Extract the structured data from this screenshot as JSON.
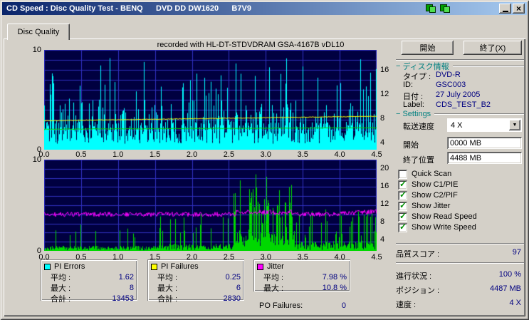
{
  "window": {
    "title": "CD Speed : Disc Quality Test - BENQ      DVD DD DW1620      B7V9"
  },
  "tab_label": "Disc Quality",
  "chart_data": {
    "annotation": "recorded with HL-DT-STDVDRAM GSA-4167B vDL10",
    "x_ticks": [
      "0.0",
      "0.5",
      "1.0",
      "1.5",
      "2.0",
      "2.5",
      "3.0",
      "3.5",
      "4.0",
      "4.5"
    ],
    "x_range": [
      0,
      4.5
    ],
    "charts": [
      {
        "id": "pi_errors",
        "type": "area",
        "bg": "#000040",
        "grid_color": "#3030c0",
        "ylim": [
          0,
          10
        ],
        "y_ticks_left": [
          10,
          0
        ],
        "y_ticks_right": [
          16,
          12,
          8,
          4
        ],
        "series": [
          {
            "name": "PI Errors",
            "color": "#00ffff",
            "style": "spikes",
            "average": 1.62,
            "maximum": 8,
            "total": 13453
          },
          {
            "name": "Read Speed",
            "color": "#ffff00",
            "style": "line",
            "from": 2.9,
            "to": 3.35
          },
          {
            "name": "Write Speed",
            "color": "#00d800",
            "style": "line",
            "from": 2.05,
            "to": 2.2
          }
        ]
      },
      {
        "id": "pi_failures_jitter",
        "type": "area",
        "bg": "#000040",
        "grid_color": "#3030c0",
        "ylim": [
          0,
          10
        ],
        "y_ticks_left": [
          10,
          0
        ],
        "y_ticks_right": [
          20,
          16,
          12,
          8,
          4
        ],
        "series": [
          {
            "name": "PI Failures",
            "color": "#00d800",
            "style": "spikes",
            "average": 0.25,
            "maximum": 6,
            "total": 2830
          },
          {
            "name": "Jitter",
            "color": "#ff00ff",
            "style": "noisy-line",
            "average_pct": 7.98,
            "maximum_pct": 10.8
          }
        ]
      }
    ]
  },
  "stats": {
    "pi_errors": {
      "title": "PI Errors",
      "swatch_color": "#00ffff",
      "rows": [
        {
          "label": "平均 :",
          "value": "1.62"
        },
        {
          "label": "最大 :",
          "value": "8"
        },
        {
          "label": "合計 :",
          "value": "13453"
        }
      ]
    },
    "pi_failures": {
      "title": "PI Failures",
      "swatch_color": "#ffff00",
      "rows": [
        {
          "label": "平均 :",
          "value": "0.25"
        },
        {
          "label": "最大 :",
          "value": "6"
        },
        {
          "label": "合計 :",
          "value": "2830"
        }
      ]
    },
    "jitter": {
      "title": "Jitter",
      "swatch_color": "#ff00ff",
      "rows": [
        {
          "label": "平均 :",
          "value": "7.98 %"
        },
        {
          "label": "最大 :",
          "value": "10.8 %"
        }
      ]
    },
    "po_failures": {
      "label": "PO Failures:",
      "value": "0"
    }
  },
  "panel": {
    "start_button": "開始",
    "exit_button": "終了(X)",
    "disc_info": {
      "header": "ディスク情報",
      "rows": [
        {
          "label": "タイプ :",
          "value": "DVD-R"
        },
        {
          "label": "ID:",
          "value": "GSC003"
        },
        {
          "label": "日付 :",
          "value": "27 July 2005"
        },
        {
          "label": "Label:",
          "value": "CDS_TEST_B2"
        }
      ]
    },
    "settings": {
      "header": "Settings",
      "speed_label": "転送速度",
      "speed_value": "4 X",
      "start_label": "開始",
      "start_value": "0000 MB",
      "end_label": "終了位置",
      "end_value": "4488 MB",
      "checkboxes": [
        {
          "label": "Quick Scan",
          "checked": false
        },
        {
          "label": "Show C1/PIE",
          "checked": true
        },
        {
          "label": "Show C2/PIF",
          "checked": true
        },
        {
          "label": "Show Jitter",
          "checked": true
        },
        {
          "label": "Show Read Speed",
          "checked": true
        },
        {
          "label": "Show Write Speed",
          "checked": true
        }
      ]
    },
    "quality_score": {
      "label": "品質スコア :",
      "value": "97"
    },
    "progress": {
      "label": "進行状況 :",
      "value": "100 %"
    },
    "position": {
      "label": "ポジション :",
      "value": "4487 MB"
    },
    "speed": {
      "label": "速度 :",
      "value": "4 X"
    }
  }
}
